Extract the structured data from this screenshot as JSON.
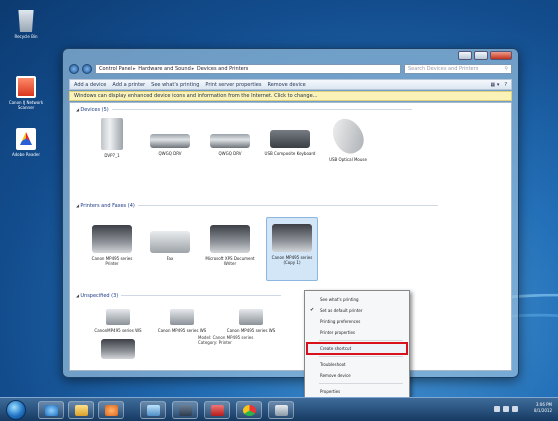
{
  "desktop": {
    "icons": [
      {
        "label": "Recycle Bin"
      },
      {
        "label": "Canon IJ Network Scanner"
      },
      {
        "label": "Adobe Reader"
      }
    ]
  },
  "window": {
    "breadcrumb": [
      "Control Panel",
      "Hardware and Sound",
      "Devices and Printers"
    ],
    "search_placeholder": "Search Devices and Printers",
    "toolbar": [
      "Add a device",
      "Add a printer",
      "See what's printing",
      "Print server properties",
      "Remove device"
    ],
    "infobar": "Windows can display enhanced device icons and information from the Internet. Click to change...",
    "groups": {
      "devices": "Devices (5)",
      "printers": "Printers and Faxes (4)",
      "unspecified": "Unspecified (3)"
    },
    "devices": [
      "DVP7_1",
      "QWGQ DRV",
      "QWGQ DRV",
      "USB Composite Keyboard",
      "USB Optical Mouse"
    ],
    "printers": [
      "Canon MP495 series Printer",
      "Fax",
      "Microsoft XPS Document Writer",
      "Canon MP495 series (Copy 1)"
    ],
    "unspecified": [
      "CanonMP495 series WS",
      "Canon MP495 series WS",
      "Canon MP495 series WS"
    ],
    "unspecified_detail": [
      "Model: Canon MP495 series",
      "Category: Printer"
    ]
  },
  "context_menu": {
    "items": [
      {
        "label": "See what's printing"
      },
      {
        "label": "Set as default printer",
        "checked": true
      },
      {
        "label": "Printing preferences"
      },
      {
        "label": "Printer properties"
      },
      {
        "label": "Create shortcut",
        "highlighted": true
      },
      {
        "label": "Troubleshoot"
      },
      {
        "label": "Remove device"
      },
      {
        "label": "Properties"
      }
    ],
    "highlight_color": "#d8111d"
  },
  "taskbar": {
    "apps": [
      "internet-explorer-icon",
      "folder-icon",
      "media-player-icon",
      "control-panel-icon",
      "paint-icon",
      "acrobat-icon",
      "chrome-icon",
      "printer-icon"
    ],
    "time": "3:06 PM",
    "date": "8/1/2012"
  }
}
